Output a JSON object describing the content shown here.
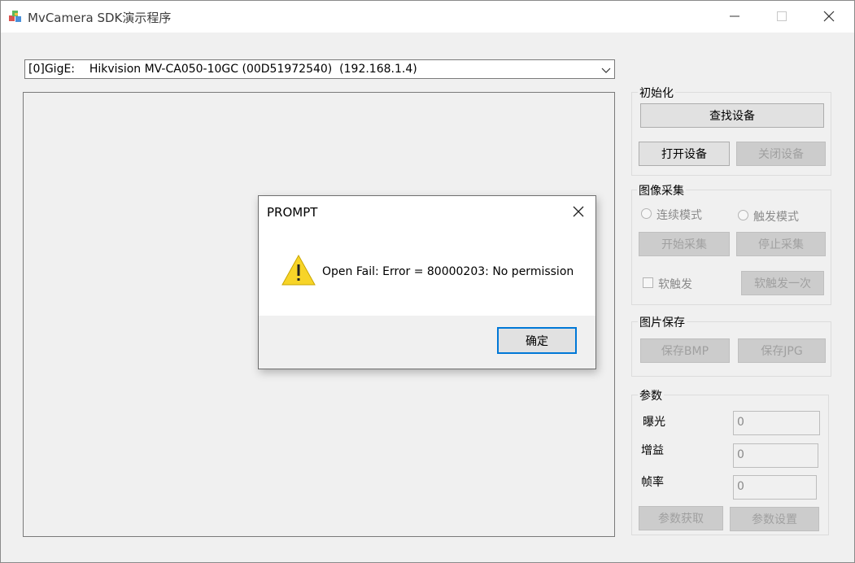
{
  "window": {
    "title": "MvCamera SDK演示程序",
    "app_icon": "camera-cubes-icon",
    "controls": {
      "minimize_icon": "minimize-icon",
      "maximize_icon": "maximize-icon",
      "close_icon": "close-icon"
    }
  },
  "device": {
    "selected": "[0]GigE:    Hikvision MV-CA050-10GC (00D51972540)  (192.168.1.4)",
    "arrow_icon": "chevron-down-icon"
  },
  "groups": {
    "init": {
      "title": "初始化",
      "find_button": "查找设备",
      "open_button": "打开设备",
      "close_button": "关闭设备"
    },
    "capture": {
      "title": "图像采集",
      "continuous_label": "连续模式",
      "trigger_label": "触发模式",
      "start_button": "开始采集",
      "stop_button": "停止采集",
      "soft_trigger_label": "软触发",
      "soft_trigger_once_button": "软触发一次"
    },
    "save": {
      "title": "图片保存",
      "bmp_button": "保存BMP",
      "jpg_button": "保存JPG"
    },
    "params": {
      "title": "参数",
      "exposure_label": "曝光",
      "exposure_value": "0",
      "gain_label": "增益",
      "gain_value": "0",
      "framerate_label": "帧率",
      "framerate_value": "0",
      "get_button": "参数获取",
      "set_button": "参数设置"
    }
  },
  "dialog": {
    "title": "PROMPT",
    "message": "Open Fail: Error = 80000203: No permission",
    "icon": "warning-icon",
    "ok_button": "确定"
  },
  "colors": {
    "accent": "#0078d7",
    "warning": "#f7d428"
  }
}
